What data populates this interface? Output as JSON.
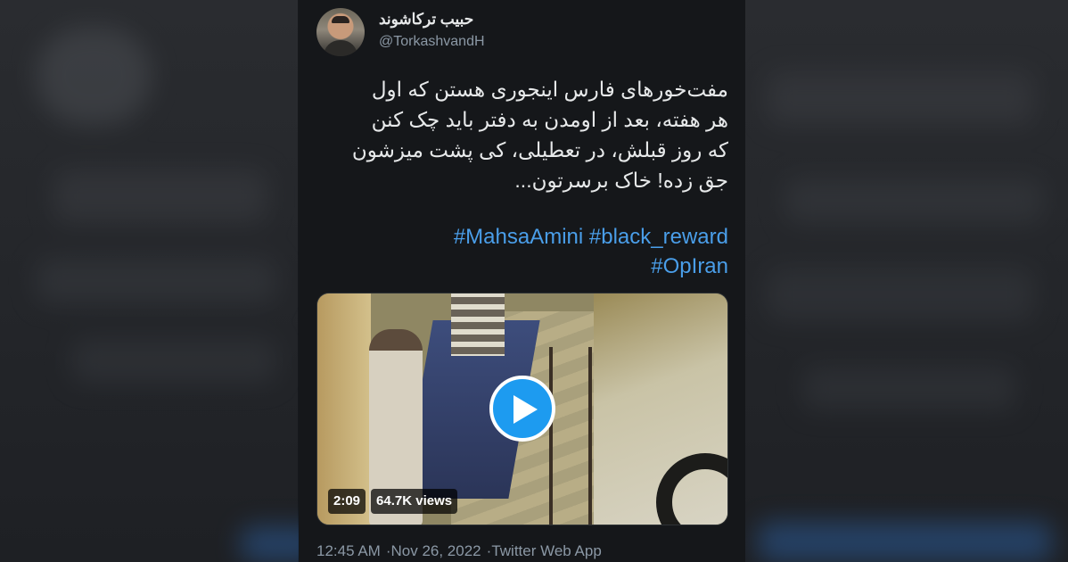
{
  "tweet": {
    "display_name": "حبیب ترکاشوند",
    "handle": "@TorkashvandH",
    "text_lines": [
      "مفت‌خورهای فارس اینجوری هستن که اول",
      "هر هفته، بعد از اومدن به دفتر باید چک کنن",
      "که روز قبلش، در تعطیلی، کی پشت میزشون",
      "جق زده! خاک برسرتون..."
    ],
    "hashtags": [
      "#MahsaAmini",
      "#black_reward",
      "#OpIran"
    ],
    "video": {
      "duration": "2:09",
      "views": "64.7K views"
    },
    "meta": {
      "time": "12:45 AM",
      "date": "Nov 26, 2022",
      "source": "Twitter Web App",
      "separator": "·"
    }
  },
  "icons": {
    "play": "play-icon"
  },
  "colors": {
    "background": "#15171a",
    "text": "#e7e9ea",
    "secondary": "#8b98a5",
    "link": "#4a9ee9",
    "accent": "#1d9bf0"
  }
}
